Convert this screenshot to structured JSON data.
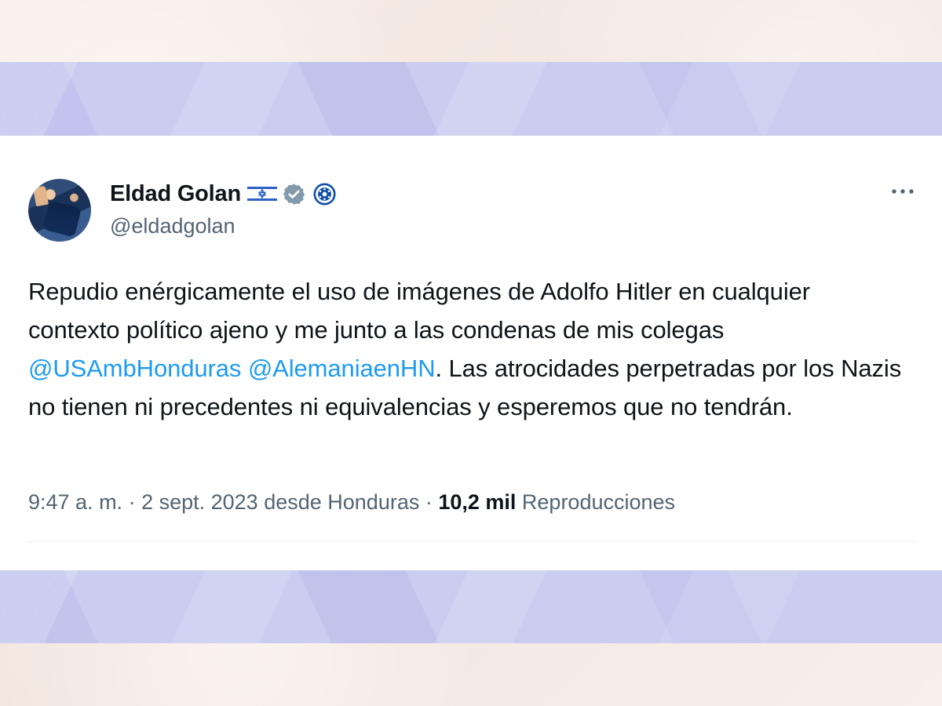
{
  "tweet": {
    "author": {
      "display_name": "Eldad Golan",
      "handle": "@eldadgolan",
      "flag_icon": "israel-flag-icon",
      "verified_icon": "verified-badge-icon",
      "government_icon": "government-badge-icon"
    },
    "text_parts": {
      "part1": "Repudio enérgicamente el uso de imágenes de Adolfo Hitler en cualquier contexto político ajeno y me junto a las condenas de mis colegas ",
      "mention1": "@USAmbHonduras",
      "space": " ",
      "mention2": "@AlemaniaenHN",
      "part2": ". Las atrocidades perpetradas por los Nazis no tienen ni precedentes ni equivalencias y esperemos que no tendrán."
    },
    "meta": {
      "time": "9:47 a. m.",
      "separator1": " · ",
      "date": "2 sept. 2023",
      "location": " desde Honduras",
      "separator2": " · ",
      "views_count": "10,2 mil",
      "views_label": " Reproducciones"
    },
    "more_icon": "more-options-icon"
  },
  "colors": {
    "background": "#f7ece6",
    "band": "#c9cdf0",
    "card": "#ffffff",
    "text": "#0f1419",
    "muted": "#536471",
    "link": "#1d9bf0",
    "divider": "#eff3f4"
  }
}
